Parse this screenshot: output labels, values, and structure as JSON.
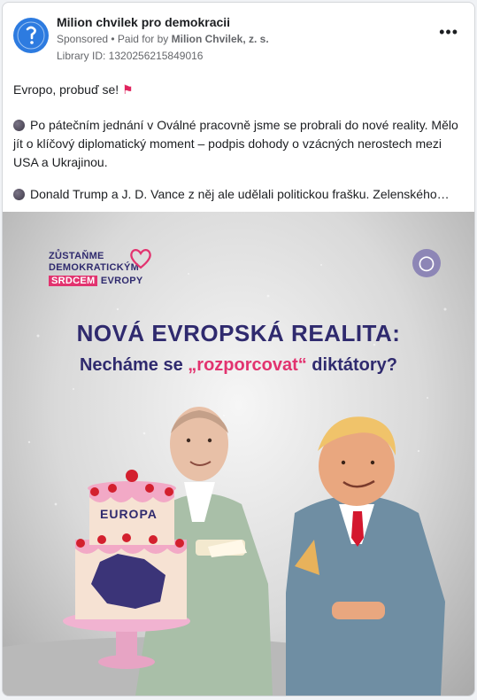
{
  "post": {
    "page_name": "Milion chvilek pro demokracii",
    "sponsored": "Sponsored",
    "paid_prefix": "• Paid for by",
    "payer": "Milion Chvilek, z. s.",
    "library_id": "Library ID: 1320256215849016",
    "more_label": "•••",
    "paragraphs": {
      "p1": "Evropo, probuď se!",
      "p2": "Po pátečním jednání v Oválné pracovně jsme se probrali do nové reality. Mělo jít o klíčový diplomatický moment – podpis dohody o vzácných nerostech mezi USA a Ukrajinou.",
      "p3": "Donald Trump a J. D. Vance z něj ale udělali politickou frašku. Zelenského…"
    }
  },
  "creative": {
    "logo_line1": "ZŮSTAŇME",
    "logo_line2": "DEMOKRATICKÝM",
    "logo_srdcem": "SRDCEM",
    "logo_evropy": "EVROPY",
    "headline": "NOVÁ EVROPSKÁ REALITA:",
    "subheadline_pre": "Necháme se ",
    "subheadline_accent": "„rozporcovat“",
    "subheadline_post": " diktátory?",
    "cake_label": "EUROPA"
  },
  "colors": {
    "brand_navy": "#2f2a6e",
    "brand_pink": "#e2336f",
    "avatar_blue": "#2d7be0"
  },
  "icons": {
    "avatar": "milion-chvilek-logo-icon",
    "more": "more-options-icon",
    "dot": "dark-circle-emoji",
    "flag": "triangular-flag-emoji",
    "heart": "heart-outline-icon"
  }
}
